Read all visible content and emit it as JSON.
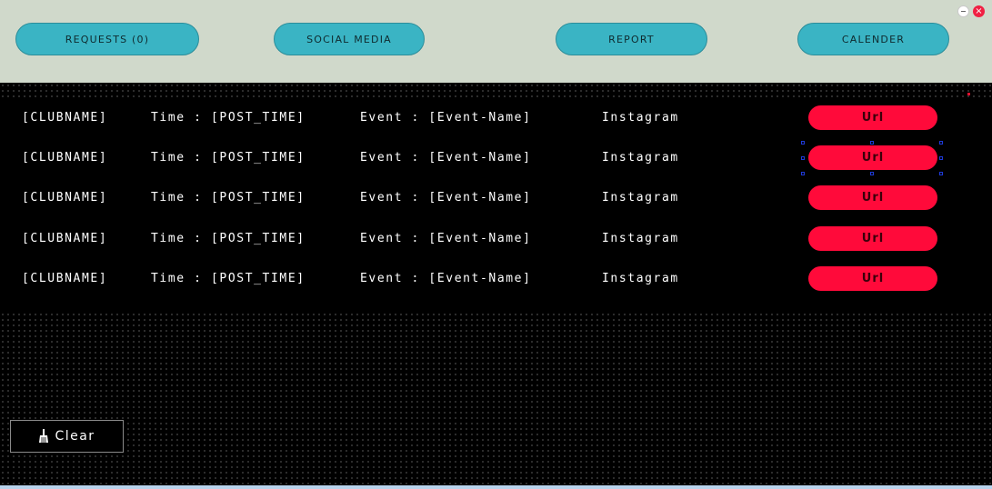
{
  "header": {
    "buttons": {
      "requests": "REQUESTS (0)",
      "social_media": "SOCIAL MEDIA",
      "report": "REPORT",
      "calender": "CALENDER"
    },
    "window_controls": {
      "minimize_icon": "minimize-icon",
      "close_icon": "close-icon",
      "close_glyph": "×"
    }
  },
  "posts": [
    {
      "club": "[CLUBNAME]",
      "time": "Time : [POST_TIME]",
      "event": "Event : [Event-Name]",
      "platform": "Instagram",
      "url_label": "Url"
    },
    {
      "club": "[CLUBNAME]",
      "time": "Time : [POST_TIME]",
      "event": "Event : [Event-Name]",
      "platform": "Instagram",
      "url_label": "Url"
    },
    {
      "club": "[CLUBNAME]",
      "time": "Time : [POST_TIME]",
      "event": "Event : [Event-Name]",
      "platform": "Instagram",
      "url_label": "Url"
    },
    {
      "club": "[CLUBNAME]",
      "time": "Time : [POST_TIME]",
      "event": "Event : [Event-Name]",
      "platform": "Instagram",
      "url_label": "Url"
    },
    {
      "club": "[CLUBNAME]",
      "time": "Time : [POST_TIME]",
      "event": "Event : [Event-Name]",
      "platform": "Instagram",
      "url_label": "Url"
    }
  ],
  "footer": {
    "clear_label": "Clear",
    "clear_icon": "broom-icon"
  },
  "colors": {
    "header_bg": "#d0d9cb",
    "nav_button": "#3ab4c4",
    "url_button": "#ff0a3a",
    "background": "#000000",
    "close_control": "#f02043"
  }
}
